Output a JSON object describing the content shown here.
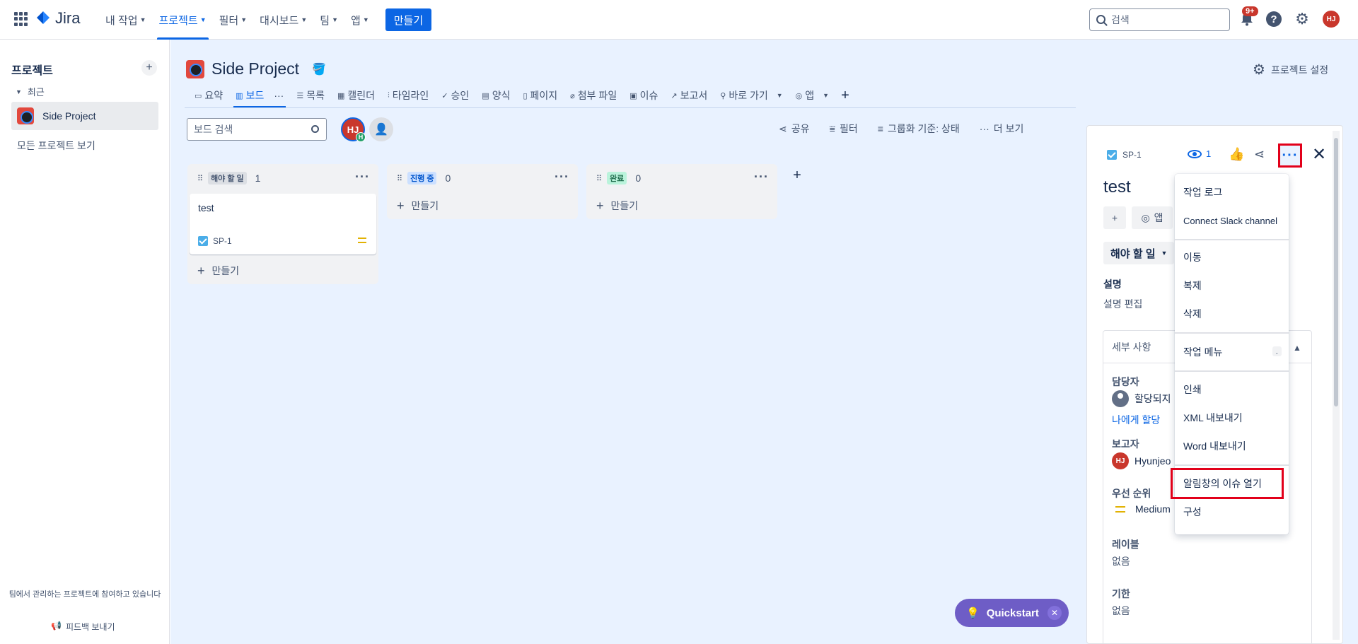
{
  "topnav": {
    "logo": "Jira",
    "items": [
      {
        "label": "내 작업"
      },
      {
        "label": "프로젝트"
      },
      {
        "label": "필터"
      },
      {
        "label": "대시보드"
      },
      {
        "label": "팀"
      },
      {
        "label": "앱"
      }
    ],
    "create_label": "만들기",
    "search_placeholder": "검색",
    "notif_badge": "9+",
    "avatar": "HJ",
    "help": "?"
  },
  "sidebar": {
    "title": "프로젝트",
    "add": "+",
    "recent_label": "최근",
    "project_name": "Side Project",
    "all_projects": "모든 프로젝트 보기",
    "footer_text": "팀에서 관리하는 프로젝트에 참여하고 있습니다",
    "feedback": "피드백 보내기"
  },
  "main": {
    "project_title": "Side Project",
    "settings_label": "프로젝트 설정",
    "tabs": [
      {
        "label": "요약",
        "icon": "▭"
      },
      {
        "label": "보드",
        "icon": "▥"
      },
      {
        "label": "목록",
        "icon": "☰"
      },
      {
        "label": "캘린더",
        "icon": "▦"
      },
      {
        "label": "타임라인",
        "icon": "⫶"
      },
      {
        "label": "승인",
        "icon": "✓"
      },
      {
        "label": "양식",
        "icon": "▤"
      },
      {
        "label": "페이지",
        "icon": "▯"
      },
      {
        "label": "첨부 파일",
        "icon": "⌀"
      },
      {
        "label": "이슈",
        "icon": "▣"
      },
      {
        "label": "보고서",
        "icon": "↗"
      },
      {
        "label": "바로 가기",
        "icon": "⚲"
      },
      {
        "label": "앱",
        "icon": "◎"
      }
    ],
    "board_search_placeholder": "보드 검색",
    "board_avatar": "HJ",
    "board_avatar_badge": "H",
    "actions": {
      "share": "공유",
      "filter": "필터",
      "group_by": "그룹화 기준: 상태",
      "more": "더 보기"
    },
    "columns": [
      {
        "name": "해야 할 일",
        "count": "1",
        "lozenge_bg": "#dcdfe4",
        "lozenge_fg": "#44546f"
      },
      {
        "name": "진행 중",
        "count": "0",
        "lozenge_bg": "#cce0ff",
        "lozenge_fg": "#0055cc"
      },
      {
        "name": "완료",
        "count": "0",
        "lozenge_bg": "#baf3db",
        "lozenge_fg": "#216e4e"
      }
    ],
    "column_create": "만들기",
    "card": {
      "title": "test",
      "key": "SP-1"
    },
    "quickstart": "Quickstart"
  },
  "issue_panel": {
    "key": "SP-1",
    "watch_count": "1",
    "title": "test",
    "app_label": "앱",
    "status": "해야 할 일",
    "description_label": "설명",
    "description_edit": "설명 편집",
    "details_label": "세부 사항",
    "assignee_label": "담당자",
    "assignee_value": "할당되지",
    "assign_to_me": "나에게 할당",
    "reporter_label": "보고자",
    "reporter_value": "Hyunjeo",
    "reporter_avatar": "HJ",
    "priority_label": "우선 순위",
    "priority_value": "Medium",
    "labels_label": "레이블",
    "labels_value": "없음",
    "due_label": "기한",
    "due_value": "없음"
  },
  "dropdown": {
    "items": [
      {
        "label": "작업 로그"
      },
      {
        "label": "Connect Slack channel"
      },
      {
        "label": "이동"
      },
      {
        "label": "복제"
      },
      {
        "label": "삭제"
      },
      {
        "label": "작업 메뉴"
      },
      {
        "label": "인쇄"
      },
      {
        "label": "XML 내보내기"
      },
      {
        "label": "Word 내보내기"
      },
      {
        "label": "알림창의 이슈 열기"
      },
      {
        "label": "구성"
      }
    ],
    "shortcut": "."
  },
  "colors": {
    "accent": "#0c66e4",
    "highlight": "#e2001a",
    "board_bg": "#e9f2ff",
    "quickstart": "#6e5dc6"
  }
}
